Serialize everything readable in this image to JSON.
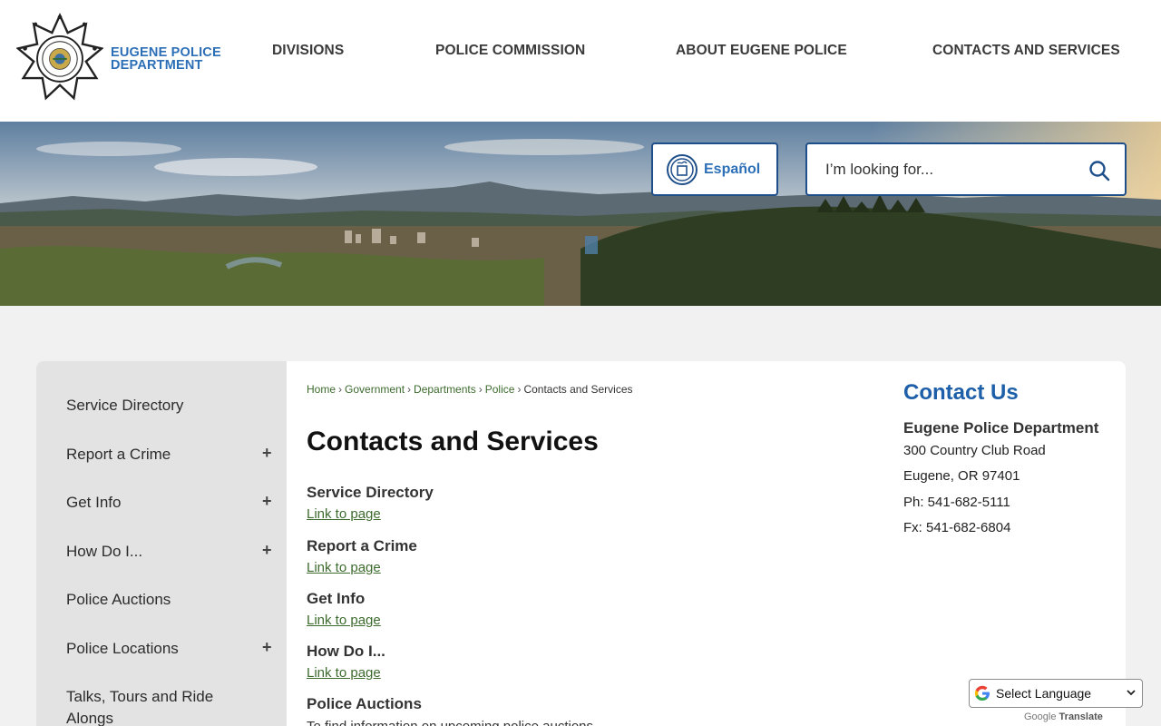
{
  "logo": {
    "line1": "EUGENE POLICE",
    "line2": "DEPARTMENT",
    "badge_text_top": "CITY OF EUGENE",
    "badge_text_bottom": "POLICE"
  },
  "nav": {
    "items": [
      {
        "label": "DIVISIONS"
      },
      {
        "label": "POLICE COMMISSION"
      },
      {
        "label": "ABOUT EUGENE POLICE"
      },
      {
        "label": "CONTACTS AND SERVICES"
      }
    ]
  },
  "hero": {
    "espanol_label": "Español",
    "search_placeholder": "I’m looking for..."
  },
  "sidebar": {
    "items": [
      {
        "label": "Service Directory",
        "expandable": false
      },
      {
        "label": "Report a Crime",
        "expandable": true
      },
      {
        "label": "Get Info",
        "expandable": true
      },
      {
        "label": "How Do I...",
        "expandable": true
      },
      {
        "label": "Police Auctions",
        "expandable": false
      },
      {
        "label": "Police Locations",
        "expandable": true
      },
      {
        "label": "Talks, Tours and Ride Alongs",
        "expandable": false
      }
    ],
    "plus_symbol": "+"
  },
  "breadcrumb": {
    "items": [
      "Home",
      "Government",
      "Departments",
      "Police"
    ],
    "current": "Contacts and Services",
    "separator": "›"
  },
  "main": {
    "title": "Contacts and Services",
    "services": [
      {
        "title": "Service Directory",
        "link": "Link to page"
      },
      {
        "title": "Report a Crime",
        "link": "Link to page"
      },
      {
        "title": "Get Info",
        "link": "Link to page"
      },
      {
        "title": "How Do I...",
        "link": "Link to page"
      },
      {
        "title": "Police Auctions",
        "description": "To find information on upcoming police auctions"
      }
    ]
  },
  "contact": {
    "title": "Contact Us",
    "org": "Eugene Police Department",
    "address1": "300 Country Club Road",
    "address2": "Eugene, OR 97401",
    "phone": "Ph: 541-682-5111",
    "fax": "Fx: 541-682-6804"
  },
  "translate": {
    "select_label": "Select Language",
    "powered_google": "Google",
    "powered_translate": "Translate"
  },
  "colors": {
    "brand_blue": "#2c6fb7",
    "border_navy": "#1f4f8b",
    "link_green": "#3d6b2e",
    "sidebar_bg": "#e3e3e3"
  }
}
